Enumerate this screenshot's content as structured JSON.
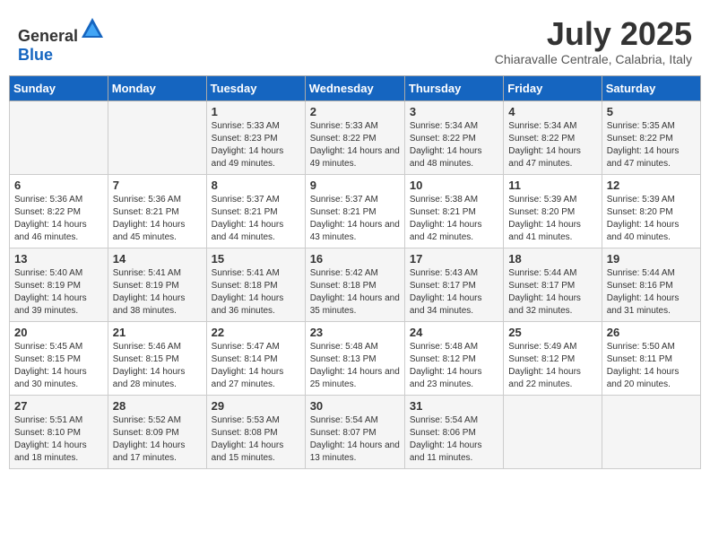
{
  "header": {
    "logo_general": "General",
    "logo_blue": "Blue",
    "title": "July 2025",
    "location": "Chiaravalle Centrale, Calabria, Italy"
  },
  "days_of_week": [
    "Sunday",
    "Monday",
    "Tuesday",
    "Wednesday",
    "Thursday",
    "Friday",
    "Saturday"
  ],
  "weeks": [
    [
      {
        "day": "",
        "detail": ""
      },
      {
        "day": "",
        "detail": ""
      },
      {
        "day": "1",
        "detail": "Sunrise: 5:33 AM\nSunset: 8:23 PM\nDaylight: 14 hours and 49 minutes."
      },
      {
        "day": "2",
        "detail": "Sunrise: 5:33 AM\nSunset: 8:22 PM\nDaylight: 14 hours and 49 minutes."
      },
      {
        "day": "3",
        "detail": "Sunrise: 5:34 AM\nSunset: 8:22 PM\nDaylight: 14 hours and 48 minutes."
      },
      {
        "day": "4",
        "detail": "Sunrise: 5:34 AM\nSunset: 8:22 PM\nDaylight: 14 hours and 47 minutes."
      },
      {
        "day": "5",
        "detail": "Sunrise: 5:35 AM\nSunset: 8:22 PM\nDaylight: 14 hours and 47 minutes."
      }
    ],
    [
      {
        "day": "6",
        "detail": "Sunrise: 5:36 AM\nSunset: 8:22 PM\nDaylight: 14 hours and 46 minutes."
      },
      {
        "day": "7",
        "detail": "Sunrise: 5:36 AM\nSunset: 8:21 PM\nDaylight: 14 hours and 45 minutes."
      },
      {
        "day": "8",
        "detail": "Sunrise: 5:37 AM\nSunset: 8:21 PM\nDaylight: 14 hours and 44 minutes."
      },
      {
        "day": "9",
        "detail": "Sunrise: 5:37 AM\nSunset: 8:21 PM\nDaylight: 14 hours and 43 minutes."
      },
      {
        "day": "10",
        "detail": "Sunrise: 5:38 AM\nSunset: 8:21 PM\nDaylight: 14 hours and 42 minutes."
      },
      {
        "day": "11",
        "detail": "Sunrise: 5:39 AM\nSunset: 8:20 PM\nDaylight: 14 hours and 41 minutes."
      },
      {
        "day": "12",
        "detail": "Sunrise: 5:39 AM\nSunset: 8:20 PM\nDaylight: 14 hours and 40 minutes."
      }
    ],
    [
      {
        "day": "13",
        "detail": "Sunrise: 5:40 AM\nSunset: 8:19 PM\nDaylight: 14 hours and 39 minutes."
      },
      {
        "day": "14",
        "detail": "Sunrise: 5:41 AM\nSunset: 8:19 PM\nDaylight: 14 hours and 38 minutes."
      },
      {
        "day": "15",
        "detail": "Sunrise: 5:41 AM\nSunset: 8:18 PM\nDaylight: 14 hours and 36 minutes."
      },
      {
        "day": "16",
        "detail": "Sunrise: 5:42 AM\nSunset: 8:18 PM\nDaylight: 14 hours and 35 minutes."
      },
      {
        "day": "17",
        "detail": "Sunrise: 5:43 AM\nSunset: 8:17 PM\nDaylight: 14 hours and 34 minutes."
      },
      {
        "day": "18",
        "detail": "Sunrise: 5:44 AM\nSunset: 8:17 PM\nDaylight: 14 hours and 32 minutes."
      },
      {
        "day": "19",
        "detail": "Sunrise: 5:44 AM\nSunset: 8:16 PM\nDaylight: 14 hours and 31 minutes."
      }
    ],
    [
      {
        "day": "20",
        "detail": "Sunrise: 5:45 AM\nSunset: 8:15 PM\nDaylight: 14 hours and 30 minutes."
      },
      {
        "day": "21",
        "detail": "Sunrise: 5:46 AM\nSunset: 8:15 PM\nDaylight: 14 hours and 28 minutes."
      },
      {
        "day": "22",
        "detail": "Sunrise: 5:47 AM\nSunset: 8:14 PM\nDaylight: 14 hours and 27 minutes."
      },
      {
        "day": "23",
        "detail": "Sunrise: 5:48 AM\nSunset: 8:13 PM\nDaylight: 14 hours and 25 minutes."
      },
      {
        "day": "24",
        "detail": "Sunrise: 5:48 AM\nSunset: 8:12 PM\nDaylight: 14 hours and 23 minutes."
      },
      {
        "day": "25",
        "detail": "Sunrise: 5:49 AM\nSunset: 8:12 PM\nDaylight: 14 hours and 22 minutes."
      },
      {
        "day": "26",
        "detail": "Sunrise: 5:50 AM\nSunset: 8:11 PM\nDaylight: 14 hours and 20 minutes."
      }
    ],
    [
      {
        "day": "27",
        "detail": "Sunrise: 5:51 AM\nSunset: 8:10 PM\nDaylight: 14 hours and 18 minutes."
      },
      {
        "day": "28",
        "detail": "Sunrise: 5:52 AM\nSunset: 8:09 PM\nDaylight: 14 hours and 17 minutes."
      },
      {
        "day": "29",
        "detail": "Sunrise: 5:53 AM\nSunset: 8:08 PM\nDaylight: 14 hours and 15 minutes."
      },
      {
        "day": "30",
        "detail": "Sunrise: 5:54 AM\nSunset: 8:07 PM\nDaylight: 14 hours and 13 minutes."
      },
      {
        "day": "31",
        "detail": "Sunrise: 5:54 AM\nSunset: 8:06 PM\nDaylight: 14 hours and 11 minutes."
      },
      {
        "day": "",
        "detail": ""
      },
      {
        "day": "",
        "detail": ""
      }
    ]
  ]
}
